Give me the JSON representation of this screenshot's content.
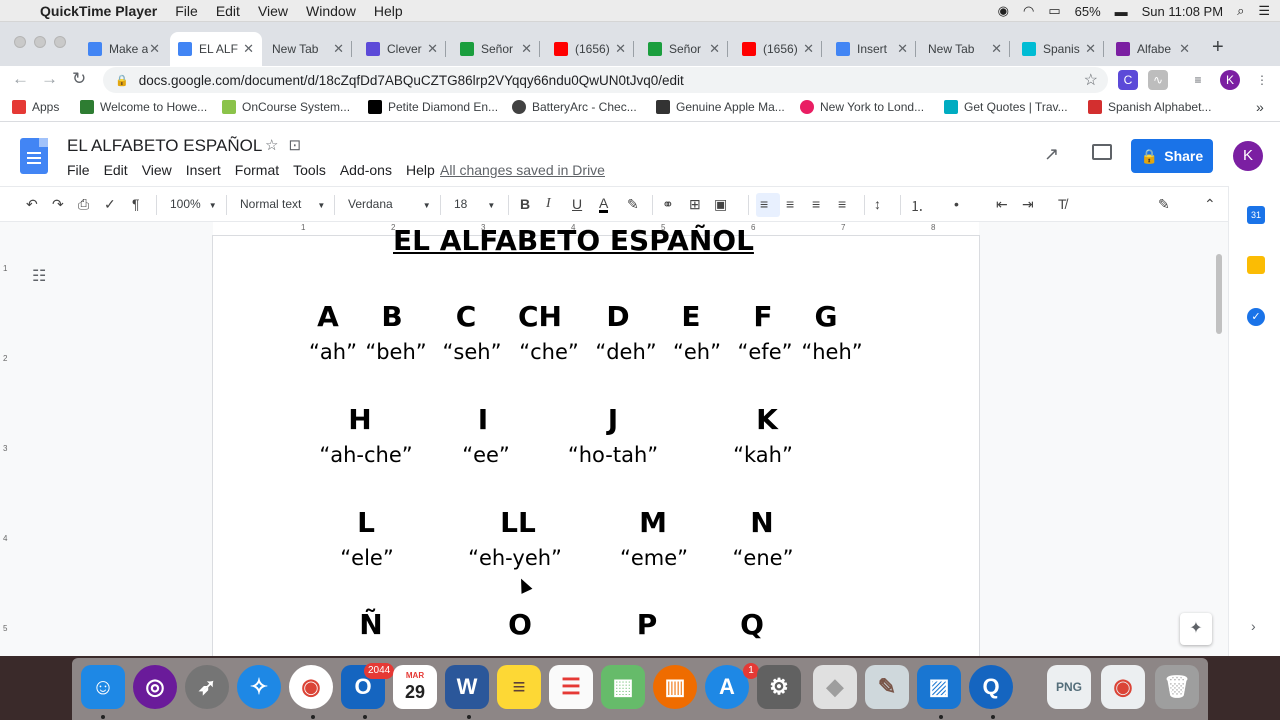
{
  "menubar": {
    "app_name": "QuickTime Player",
    "items": [
      "File",
      "Edit",
      "View",
      "Window",
      "Help"
    ],
    "battery": "65%",
    "clock": "Sun 11:08 PM"
  },
  "tabs": [
    {
      "title": "Make a",
      "color": "#4285f4"
    },
    {
      "title": "EL ALF",
      "color": "#4285f4"
    },
    {
      "title": "New Tab",
      "color": ""
    },
    {
      "title": "Clever",
      "color": "#5c4ad8"
    },
    {
      "title": "Señor",
      "color": "#1b9e3e"
    },
    {
      "title": "(1656)",
      "color": "#ff0000"
    },
    {
      "title": "Señor",
      "color": "#1b9e3e"
    },
    {
      "title": "(1656)",
      "color": "#ff0000"
    },
    {
      "title": "Insert",
      "color": "#4285f4"
    },
    {
      "title": "New Tab",
      "color": ""
    },
    {
      "title": "Spanis",
      "color": "#00bcd4"
    },
    {
      "title": "Alfabe",
      "color": "#7b1fa2"
    }
  ],
  "address_bar": {
    "url": "docs.google.com/document/d/18cZqfDd7ABQuCZTG86lrp2VYqqy66ndu0QwUN0tJvq0/edit"
  },
  "bookmarks": [
    {
      "label": "Apps",
      "color": "#e53935"
    },
    {
      "label": "Welcome to Howe...",
      "color": "#2e7d32"
    },
    {
      "label": "OnCourse System...",
      "color": "#8bc34a"
    },
    {
      "label": "Petite Diamond En...",
      "color": "#000000"
    },
    {
      "label": "BatteryArc - Chec...",
      "color": "#424242"
    },
    {
      "label": "Genuine Apple Ma...",
      "color": "#333333"
    },
    {
      "label": "New York to Lond...",
      "color": "#e91e63"
    },
    {
      "label": "Get Quotes | Trav...",
      "color": "#00acc1"
    },
    {
      "label": "Spanish Alphabet...",
      "color": "#d32f2f"
    }
  ],
  "doc": {
    "title": "EL ALFABETO ESPAÑOL",
    "menu": [
      "File",
      "Edit",
      "View",
      "Insert",
      "Format",
      "Tools",
      "Add-ons",
      "Help"
    ],
    "saved_status": "All changes saved in Drive",
    "share_label": "Share",
    "avatar_letter": "K"
  },
  "format_toolbar": {
    "zoom": "100%",
    "style": "Normal text",
    "font": "Verdana",
    "size": "18"
  },
  "ruler": {
    "marks": [
      "1",
      "2",
      "3",
      "4",
      "5",
      "6",
      "7",
      "8"
    ],
    "vertical_marks": [
      "1",
      "2",
      "3",
      "4",
      "5"
    ]
  },
  "content": {
    "heading": "EL ALFABETO ESPAÑOL",
    "rows": [
      {
        "letters": [
          "A",
          "B",
          "C",
          "CH",
          "D",
          "E",
          "F",
          "G"
        ],
        "prons": [
          "“ah”",
          "“beh”",
          "“seh”",
          "“che”",
          "“deh”",
          "“eh”",
          "“efe”",
          "“heh”"
        ]
      },
      {
        "letters": [
          "H",
          "I",
          "J",
          "K"
        ],
        "prons": [
          "“ah-che”",
          "“ee”",
          "“ho-tah”",
          "“kah”"
        ]
      },
      {
        "letters": [
          "L",
          "LL",
          "M",
          "N"
        ],
        "prons": [
          "“ele”",
          "“eh-yeh”",
          "“eme”",
          "“ene”"
        ]
      },
      {
        "letters": [
          "Ñ",
          "O",
          "P",
          "Q"
        ],
        "prons": []
      }
    ]
  },
  "dock": {
    "outlook_badge": "2044",
    "calendar_month": "MAR",
    "calendar_day": "29",
    "appstore_badge": "1"
  }
}
